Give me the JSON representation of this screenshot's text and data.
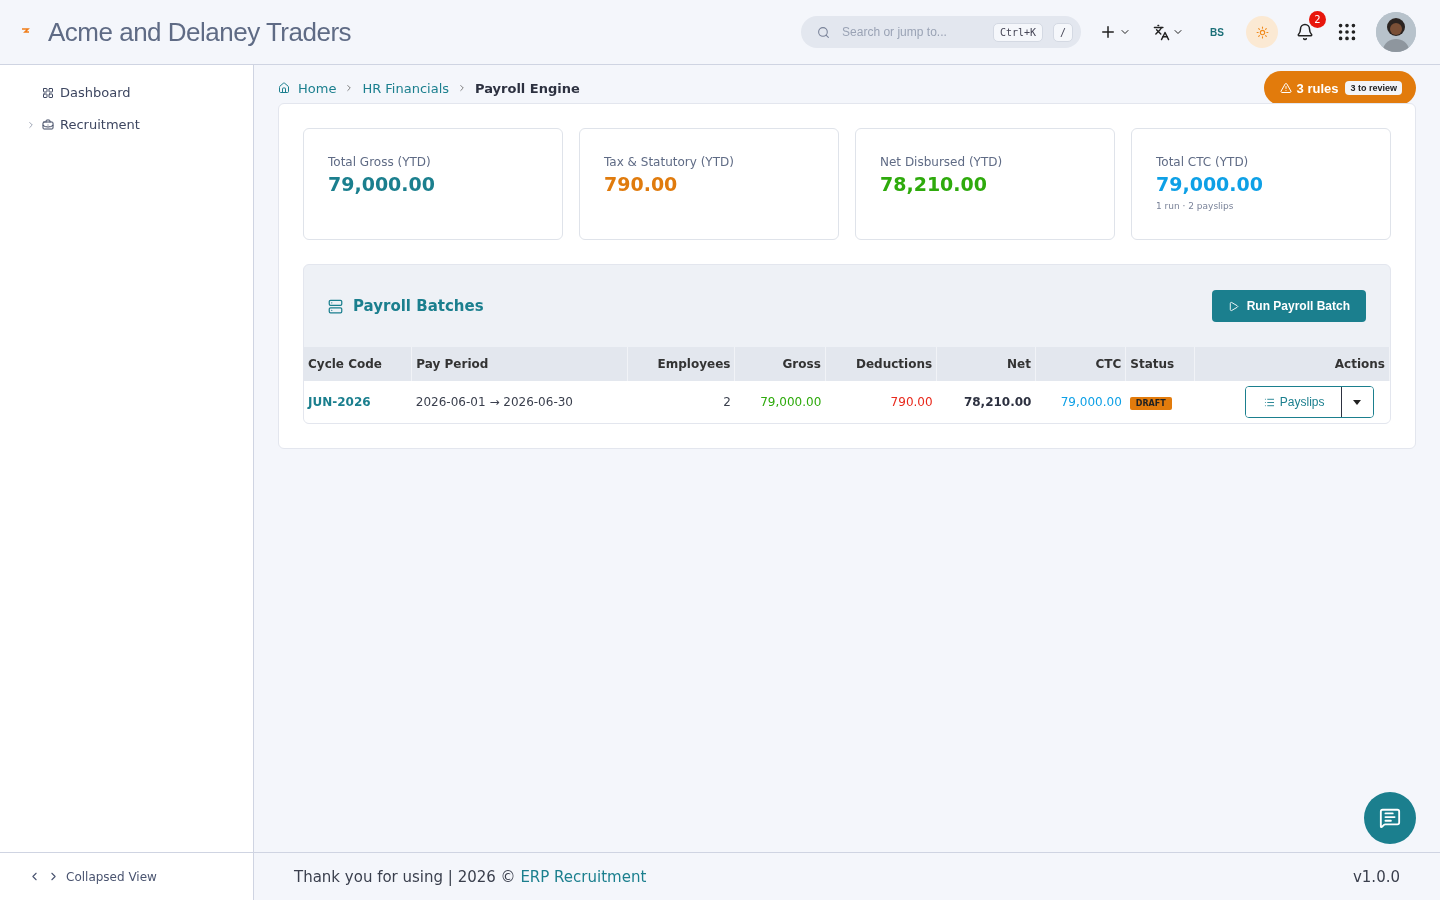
{
  "header": {
    "company": "Acme and Delaney Traders",
    "search": {
      "placeholder": "Search or jump to...",
      "shortcuts": [
        "Ctrl+K",
        "/"
      ]
    },
    "user_initials": "BS",
    "notifications": "2"
  },
  "sidebar": {
    "items": [
      {
        "label": "Dashboard",
        "expandable": false
      },
      {
        "label": "Recruitment",
        "expandable": true
      }
    ]
  },
  "breadcrumb": [
    {
      "label": "Home",
      "current": false
    },
    {
      "label": "HR Financials",
      "current": false
    },
    {
      "label": "Payroll Engine",
      "current": true
    }
  ],
  "rules_alert": {
    "label": "3 rules",
    "badge": "3 to review"
  },
  "stats": [
    {
      "label": "Total Gross (YTD)",
      "value": "79,000.00",
      "color": "#1b7f8e"
    },
    {
      "label": "Tax & Statutory (YTD)",
      "value": "790.00",
      "color": "#e07b0d"
    },
    {
      "label": "Net Disbursed (YTD)",
      "value": "78,210.00",
      "color": "#2eaa0c"
    },
    {
      "label": "Total CTC (YTD)",
      "value": "79,000.00",
      "color": "#0ea0e6",
      "note": "1 run · 2 payslips"
    }
  ],
  "batches": {
    "title": "Payroll Batches",
    "run_button": "Run Payroll Batch",
    "columns": [
      "Cycle Code",
      "Pay Period",
      "Employees",
      "Gross",
      "Deductions",
      "Net",
      "CTC",
      "Status",
      "Actions"
    ],
    "rows": [
      {
        "cycle_code": "JUN-2026",
        "pay_period": "2026-06-01 → 2026-06-30",
        "employees": "2",
        "gross": "79,000.00",
        "deductions": "790.00",
        "net": "78,210.00",
        "ctc": "79,000.00",
        "status": "DRAFT",
        "action": "Payslips"
      }
    ]
  },
  "sidebar_footer": "Collapsed View",
  "footer": {
    "text": "Thank you for using | 2026 © ",
    "link": "ERP Recruitment",
    "version": "v1.0.0"
  }
}
